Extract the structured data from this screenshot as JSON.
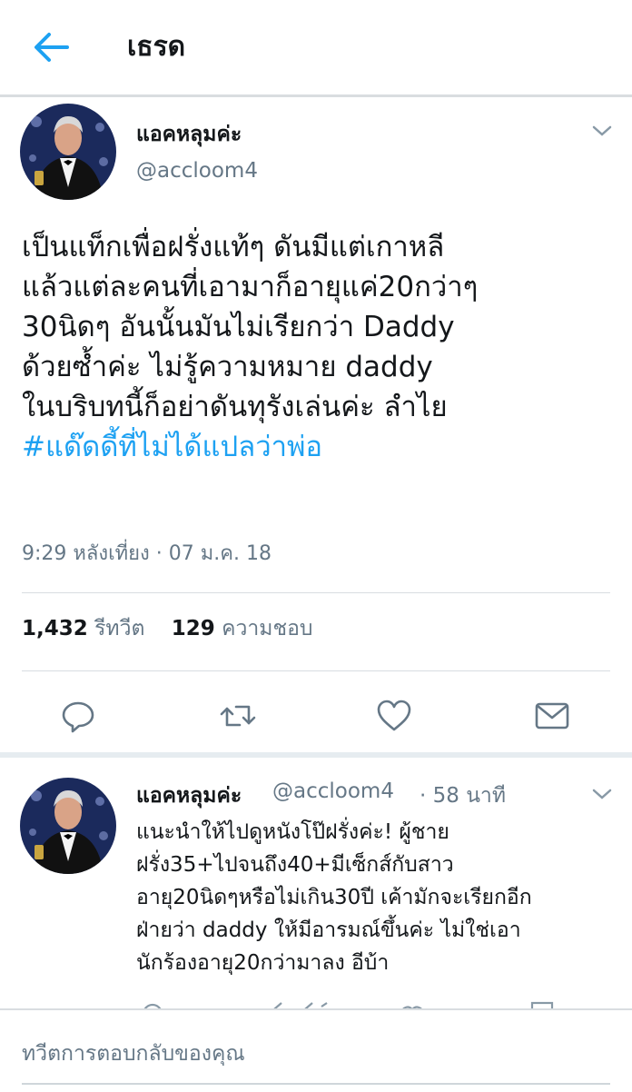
{
  "header": {
    "title": "เธรด"
  },
  "tweet": {
    "author_name": "แอคหลุมค่ะ",
    "author_handle": "@accloom4",
    "lines": [
      "เป็นแท็กเพื่อฝรั่งแท้ๆ ดันมีแต่เกาหลี",
      "แล้วแต่ละคนที่เอามาก็อายุแค่20กว่าๆ",
      "30นิดๆ อันนั้นมันไม่เรียกว่า Daddy",
      "ด้วยซ้ำค่ะ ไม่รู้ความหมาย daddy",
      "ในบริบทนี้ก็อย่าดันทุรังเล่นค่ะ ลำไย"
    ],
    "hashtag": "#แด๊ดดี้ที่ไม่ได้แปลว่าพ่อ",
    "timestamp": "9:29 หลังเที่ยง · 07 ม.ค. 18",
    "retweet_count": "1,432",
    "retweet_label": "รีทวีต",
    "like_count": "129",
    "like_label": "ความชอบ"
  },
  "reply": {
    "author_name": "แอคหลุมค่ะ",
    "author_handle": "@accloom4",
    "time": "· 58 นาที",
    "lines": [
      "แนะนำให้ไปดูหนังโป๊ฝรั่งค่ะ! ผู้ชาย",
      "ฝรั่ง35+ไปจนถึง40+มีเซ็กส์กับสาว",
      "อายุ20นิดๆหรือไม่เกิน30ปี เค้ามักจะเรียกอีก",
      "ฝ่ายว่า daddy ให้มีอารมณ์ขึ้นค่ะ ไม่ใช่เอา",
      "นักร้องอายุ20กว่ามาลง อีบ้า"
    ]
  },
  "composer": {
    "placeholder": "ทวีตการตอบกลับของคุณ"
  },
  "colors": {
    "accent": "#1da1f2",
    "secondary_text": "#657786",
    "primary_text": "#14171a",
    "divider": "#d8dde1"
  },
  "icons": [
    "back-arrow-icon",
    "chevron-down-icon",
    "reply-icon",
    "retweet-icon",
    "like-icon",
    "message-icon"
  ]
}
